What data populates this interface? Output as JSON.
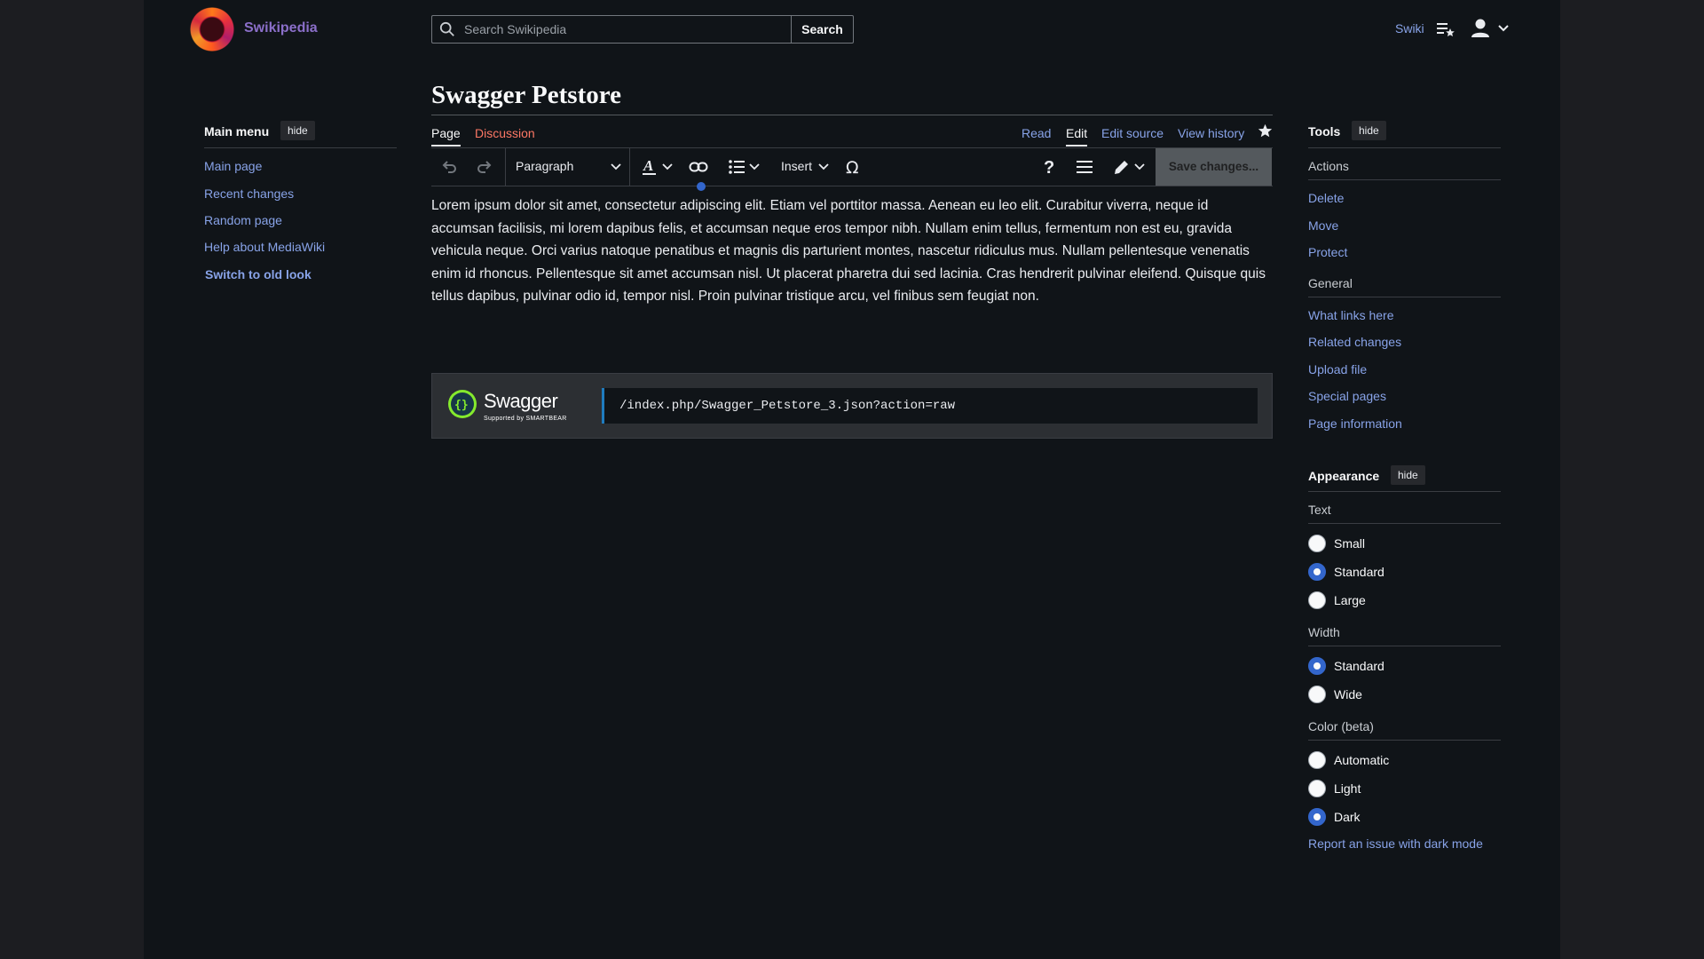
{
  "header": {
    "site_name": "Swikipedia",
    "search_placeholder": "Search Swikipedia",
    "search_button": "Search",
    "user_name": "Swiki"
  },
  "main_menu": {
    "title": "Main menu",
    "hide_label": "hide",
    "items": [
      "Main page",
      "Recent changes",
      "Random page",
      "Help about MediaWiki"
    ],
    "switch_label": "Switch to old look"
  },
  "page": {
    "title": "Swagger Petstore",
    "tabs_left": [
      "Page",
      "Discussion"
    ],
    "tabs_right": [
      "Read",
      "Edit",
      "Edit source",
      "View history"
    ]
  },
  "toolbar": {
    "paragraph_label": "Paragraph",
    "insert_label": "Insert",
    "save_label": "Save changes..."
  },
  "content": {
    "text": "Lorem ipsum dolor sit amet, consectetur adipiscing elit. Etiam vel porttitor massa. Aenean eu leo elit. Curabitur viverra, neque id accumsan facilisis, mi lorem dapibus felis, et accumsan neque eros tempor nibh. Nullam enim tellus, fermentum non est eu, gravida vehicula neque. Orci varius natoque penatibus et magnis dis parturient montes, nascetur ridiculus mus. Nullam pellentesque venenatis enim id rhoncus. Pellentesque sit amet accumsan nisl. Ut placerat pharetra dui sed lacinia. Cras hendrerit pulvinar eleifend. Quisque quis tellus dapibus, pulvinar odio id, tempor nisl. Proin pulvinar tristique arcu, vel finibus sem feugiat non."
  },
  "swagger": {
    "name": "Swagger",
    "supported_by": "Supported by SMARTBEAR",
    "url": "/index.php/Swagger_Petstore_3.json?action=raw"
  },
  "tools": {
    "title": "Tools",
    "hide_label": "hide",
    "actions_label": "Actions",
    "actions": [
      "Delete",
      "Move",
      "Protect"
    ],
    "general_label": "General",
    "general": [
      "What links here",
      "Related changes",
      "Upload file",
      "Special pages",
      "Page information"
    ]
  },
  "appearance": {
    "title": "Appearance",
    "hide_label": "hide",
    "text_label": "Text",
    "text_options": [
      "Small",
      "Standard",
      "Large"
    ],
    "text_selected": "Standard",
    "width_label": "Width",
    "width_options": [
      "Standard",
      "Wide"
    ],
    "width_selected": "Standard",
    "color_label": "Color (beta)",
    "color_options": [
      "Automatic",
      "Light",
      "Dark"
    ],
    "color_selected": "Dark",
    "report_link": "Report an issue with dark mode"
  },
  "colors": {
    "background": "#101418",
    "link": "#88a3e8",
    "red_link": "#fd7865",
    "accent": "#3366cc",
    "swagger_green": "#85ea2d"
  }
}
